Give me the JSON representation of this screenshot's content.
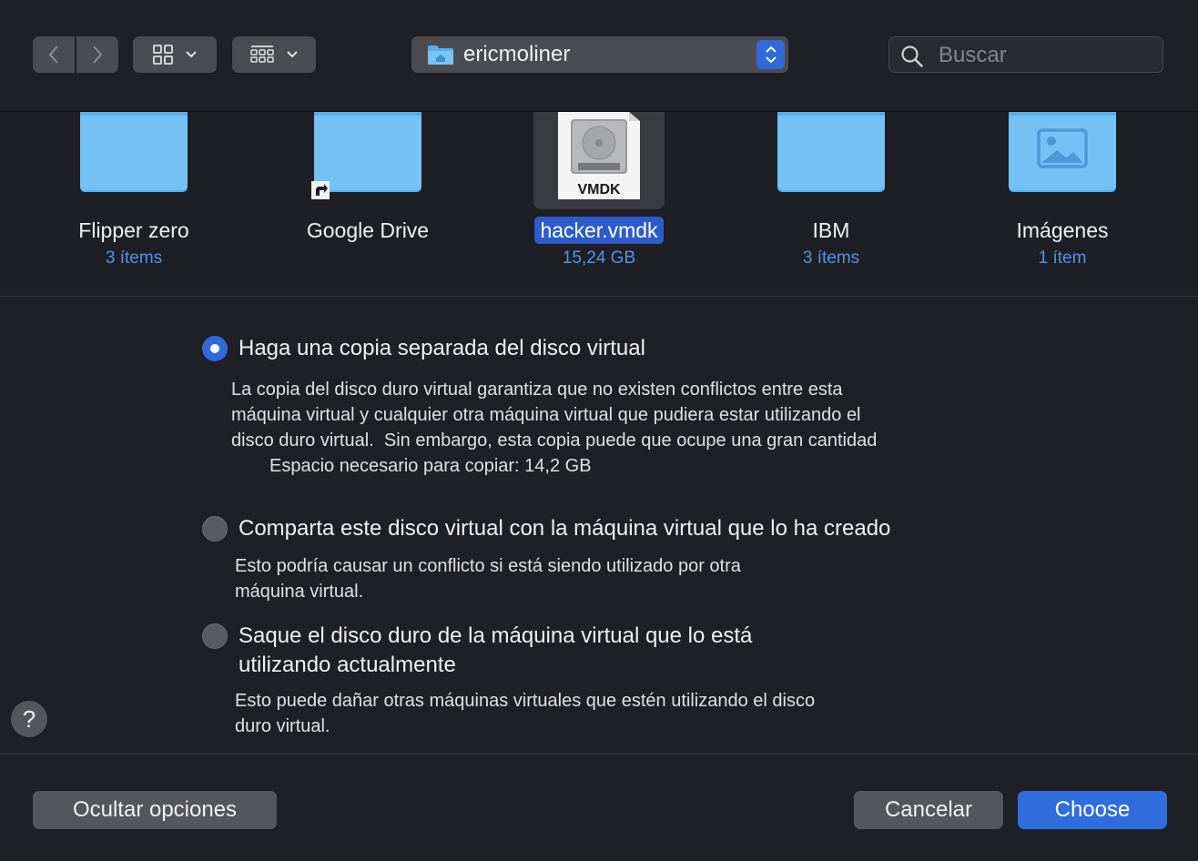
{
  "toolbar": {
    "back_icon": "chevron-left-icon",
    "forward_icon": "chevron-right-icon",
    "view_icons": "grid-view-icon",
    "view_group": "group-view-icon",
    "path_label": "ericmoliner",
    "search_placeholder": "Buscar"
  },
  "files": [
    {
      "name": "Flipper zero",
      "sub": "3 ítems",
      "kind": "folder"
    },
    {
      "name": "Google Drive",
      "sub": "",
      "kind": "folder-alias"
    },
    {
      "name": "hacker.vmdk",
      "sub": "15,24 GB",
      "kind": "vmdk",
      "selected": true,
      "badge": "VMDK"
    },
    {
      "name": "IBM",
      "sub": "3 ítems",
      "kind": "folder"
    },
    {
      "name": "Imágenes",
      "sub": "1 ítem",
      "kind": "pictures-folder"
    }
  ],
  "options": {
    "copy": {
      "label": "Haga una copia separada del disco virtual",
      "desc": "La copia del disco duro virtual garantiza que no existen conflictos entre esta\nmáquina virtual y cualquier otra máquina virtual que pudiera estar utilizando el\ndisco duro virtual.  Sin embargo, esta copia puede que ocupe una gran cantidad",
      "space": "Espacio necesario para copiar: 14,2 GB",
      "selected": true
    },
    "share": {
      "label": "Comparta este disco virtual con la máquina virtual que lo ha creado",
      "desc": "Esto podría causar un conflicto si está siendo utilizado por otra\nmáquina virtual.",
      "selected": false
    },
    "remove": {
      "label_line1": "Saque el disco duro de la máquina virtual que lo está",
      "label_line2": "utilizando actualmente",
      "desc": "Esto puede dañar otras máquinas virtuales que estén utilizando el disco\nduro virtual.",
      "selected": false
    }
  },
  "footer": {
    "help": "?",
    "hide_options": "Ocultar opciones",
    "cancel": "Cancelar",
    "choose": "Choose"
  },
  "colors": {
    "accent": "#2f6ddd",
    "folder": "#6cc0f5",
    "link_blue": "#4f95e8"
  }
}
